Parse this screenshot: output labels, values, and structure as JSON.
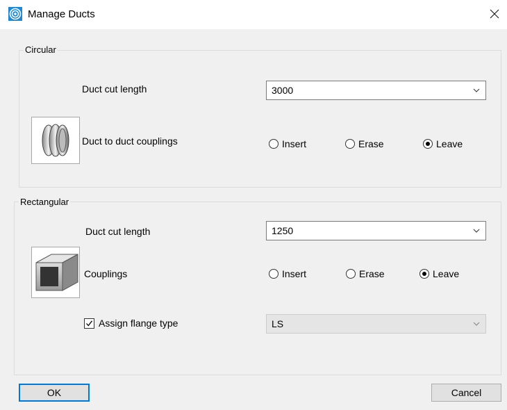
{
  "window": {
    "title": "Manage Ducts",
    "icon": "manage-ducts-app-icon",
    "close_icon": "close-icon"
  },
  "circular": {
    "legend": "Circular",
    "duct_cut_length": {
      "label": "Duct cut length",
      "value": "3000"
    },
    "couplings": {
      "label": "Duct to duct couplings",
      "image": "circular-coupling-thumbnail",
      "options": [
        "Insert",
        "Erase",
        "Leave"
      ],
      "selected": "Leave"
    }
  },
  "rectangular": {
    "legend": "Rectangular",
    "duct_cut_length": {
      "label": "Duct cut length",
      "value": "1250"
    },
    "couplings": {
      "label": "Couplings",
      "image": "rectangular-duct-thumbnail",
      "options": [
        "Insert",
        "Erase",
        "Leave"
      ],
      "selected": "Leave"
    },
    "assign_flange": {
      "label": "Assign flange type",
      "checked": true,
      "value": "LS",
      "disabled": true
    }
  },
  "buttons": {
    "ok": "OK",
    "cancel": "Cancel"
  },
  "colors": {
    "accent": "#0078d7",
    "background": "#f0f0f0"
  }
}
